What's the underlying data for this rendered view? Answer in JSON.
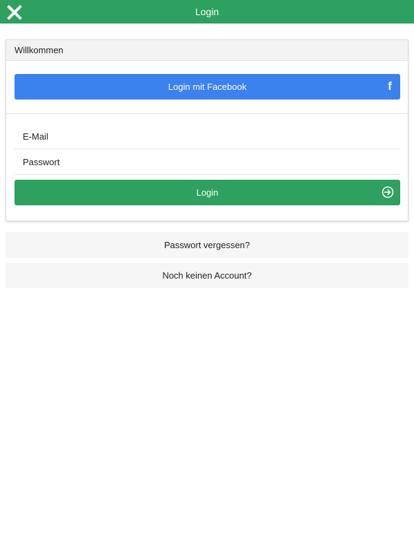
{
  "header": {
    "title": "Login",
    "close_icon": "close-icon",
    "background_color": "#2ea05f"
  },
  "card": {
    "title": "Willkommen",
    "facebook_button": {
      "label": "Login mit Facebook",
      "icon": "facebook-icon",
      "color": "#3b82ef"
    },
    "email_field": {
      "placeholder": "E-Mail",
      "value": ""
    },
    "password_field": {
      "placeholder": "Passwort",
      "value": ""
    },
    "login_button": {
      "label": "Login",
      "icon": "login-arrow-icon",
      "color": "#2ea05f"
    }
  },
  "links": {
    "forgot_password": "Passwort vergessen?",
    "no_account": "Noch keinen Account?"
  }
}
